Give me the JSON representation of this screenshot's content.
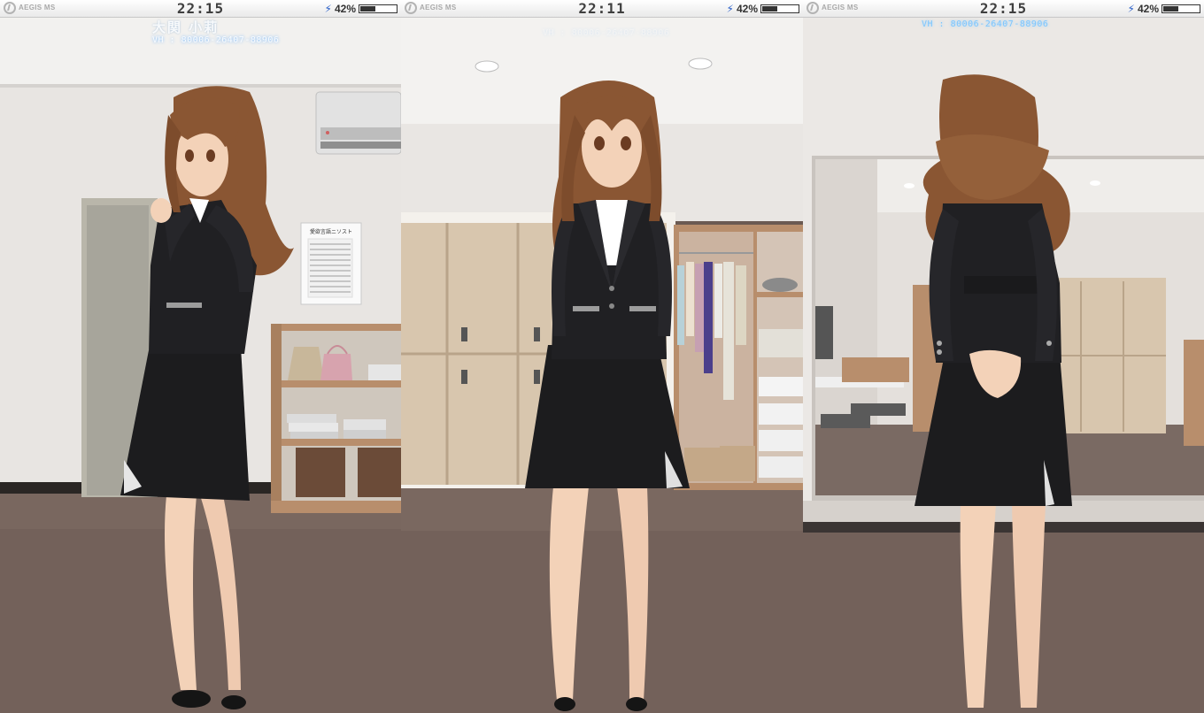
{
  "panels": [
    {
      "brand": {
        "name": "AEGIS MS",
        "icon": "aegis-logo-icon"
      },
      "time": "22:15",
      "battery": {
        "percent_text": "42%",
        "level": 0.42,
        "icon": "charging-bolt-icon",
        "glyph": "⚡"
      },
      "hud": {
        "name": "大関 小莉",
        "id": "VH : 80006-26407-88906"
      }
    },
    {
      "brand": {
        "name": "AEGIS MS",
        "icon": "aegis-logo-icon"
      },
      "time": "22:11",
      "battery": {
        "percent_text": "42%",
        "level": 0.42,
        "icon": "charging-bolt-icon",
        "glyph": "⚡"
      },
      "hud": {
        "id": "VH : 80006-26407-88906"
      }
    },
    {
      "brand": {
        "name": "AEGIS MS",
        "icon": "aegis-logo-icon"
      },
      "time": "22:15",
      "battery": {
        "percent_text": "42%",
        "level": 0.42,
        "icon": "charging-bolt-icon",
        "glyph": "⚡"
      },
      "hud": {
        "id": "VH : 80006-26407-88906"
      }
    }
  ],
  "scene": {
    "poster_title": "愛欲言語ニソスト",
    "colors": {
      "wall": "#e9e6e3",
      "carpet": "#73615a",
      "suit": "#1c1c1e",
      "hair": "#8a5633",
      "skin": "#f3d2b8",
      "locker": "#d8c6ae",
      "shelf_wood": "#b88e6c",
      "hud_glow": "#7cc6ff"
    }
  }
}
